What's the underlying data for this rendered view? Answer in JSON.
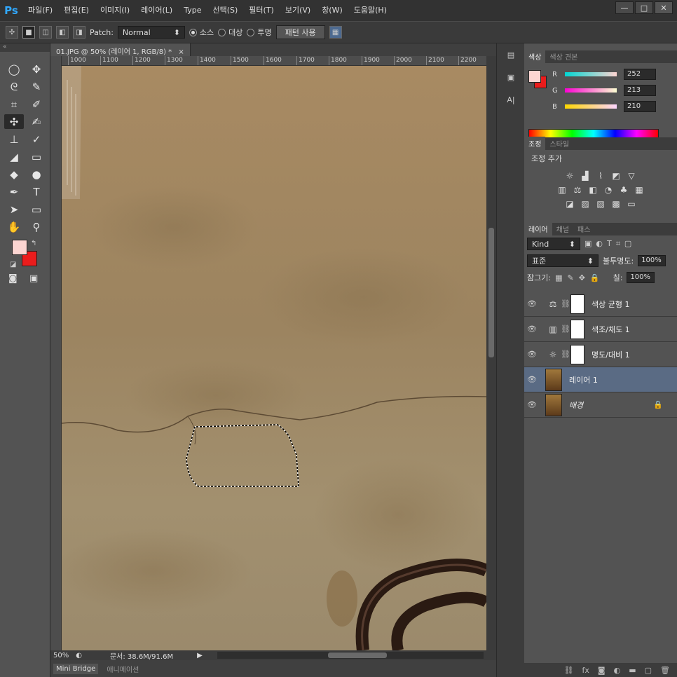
{
  "app": {
    "logo": "Ps"
  },
  "menu": [
    "파일(F)",
    "편집(E)",
    "이미지(I)",
    "레이어(L)",
    "Type",
    "선택(S)",
    "필터(T)",
    "보기(V)",
    "창(W)",
    "도움말(H)"
  ],
  "window_buttons": [
    "—",
    "□",
    "✕"
  ],
  "options": {
    "patch_label": "Patch:",
    "patch_value": "Normal",
    "source_label": "소스",
    "dest_label": "대상",
    "transparent_label": "투명",
    "use_pattern_label": "패턴 사용"
  },
  "document": {
    "tab_title": "01.JPG @ 50% (레이어 1, RGB/8) *",
    "zoom": "50%",
    "doc_size": "문서: 38.6M/91.6M",
    "ruler_top": [
      "1000",
      "1100",
      "1200",
      "1300",
      "1400",
      "1500",
      "1600",
      "1700",
      "1800",
      "1900",
      "2000",
      "2100",
      "2200"
    ]
  },
  "bottom_tabs": [
    "Mini Bridge",
    "애니메이션"
  ],
  "color_panel": {
    "tabs": [
      "색상",
      "색상 견본"
    ],
    "r_label": "R",
    "r_value": "252",
    "g_label": "G",
    "g_value": "213",
    "b_label": "B",
    "b_value": "210",
    "foreground": "#fcd5d2",
    "background": "#ea1c1c"
  },
  "adjust_panel": {
    "tabs": [
      "조정",
      "스타일"
    ],
    "title": "조정 추가"
  },
  "layers_panel": {
    "tabs": [
      "레이어",
      "채널",
      "패스"
    ],
    "kind_label": "Kind",
    "blend_mode": "표준",
    "opacity_label": "불투명도:",
    "opacity_value": "100%",
    "lock_label": "잠그기:",
    "fill_label": "칠:",
    "fill_value": "100%",
    "layers": [
      {
        "name": "색상 균형 1",
        "kind": "adjustment"
      },
      {
        "name": "색조/채도 1",
        "kind": "adjustment"
      },
      {
        "name": "명도/대비 1",
        "kind": "adjustment"
      },
      {
        "name": "레이어 1",
        "kind": "image"
      },
      {
        "name": "배경",
        "kind": "image"
      }
    ]
  }
}
